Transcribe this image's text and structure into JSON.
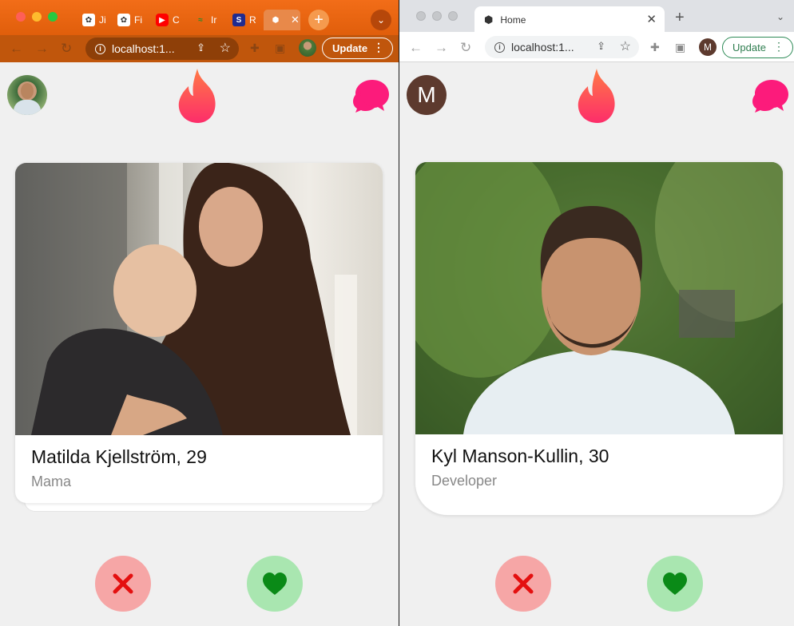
{
  "colors": {
    "nope_bg": "#f6a6a6",
    "nope_icon": "#e41010",
    "like_bg": "#a9e6b0",
    "like_icon": "#0a8a17",
    "brand": "#fe3c72"
  },
  "left_window": {
    "tabs": [
      {
        "label": "Ji",
        "icon": "gear-icon"
      },
      {
        "label": "Fi",
        "icon": "gear-icon"
      },
      {
        "label": "C",
        "icon": "youtube-icon"
      },
      {
        "label": "Ir",
        "icon": "snake-icon"
      },
      {
        "label": "R",
        "icon": "s-logo-icon"
      },
      {
        "label": "",
        "icon": "cube-icon"
      }
    ],
    "url": "localhost:1...",
    "update_label": "Update",
    "profile": {
      "name": "Matilda Kjellström, 29",
      "job": "Mama"
    }
  },
  "right_window": {
    "tab_title": "Home",
    "url": "localhost:1...",
    "update_label": "Update",
    "avatar_letter": "M",
    "profile": {
      "name": "Kyl Manson-Kullin, 30",
      "job": "Developer"
    }
  }
}
